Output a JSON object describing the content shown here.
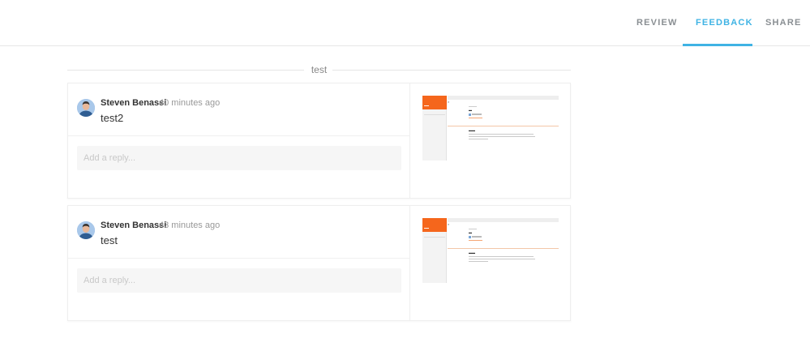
{
  "nav": {
    "tabs": [
      {
        "label": "REVIEW",
        "active": false
      },
      {
        "label": "FEEDBACK",
        "active": true
      },
      {
        "label": "SHARE",
        "active": false
      }
    ]
  },
  "colors": {
    "accent": "#3fb3e4",
    "thumbnail_brand": "#f5661c"
  },
  "group": {
    "label": "test"
  },
  "comments": [
    {
      "author": "Steven Benassi",
      "time": "40 minutes ago",
      "text": "test2",
      "reply_placeholder": "Add a reply...",
      "avatar_icon": "user-avatar-photo",
      "thumbnail_icon": "page-preview-thumbnail"
    },
    {
      "author": "Steven Benassi",
      "time": "43 minutes ago",
      "text": "test",
      "reply_placeholder": "Add a reply...",
      "avatar_icon": "user-avatar-photo",
      "thumbnail_icon": "page-preview-thumbnail"
    }
  ]
}
